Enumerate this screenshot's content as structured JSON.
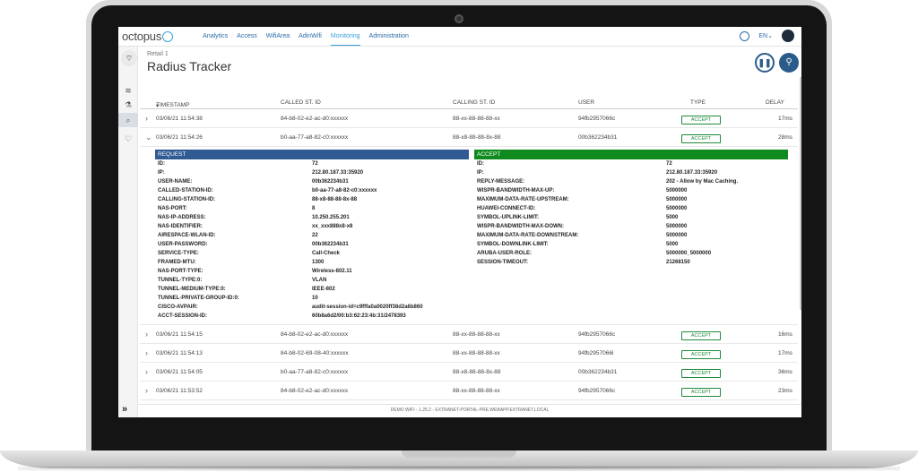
{
  "app": {
    "logo_text": "octopus"
  },
  "nav": [
    "Analytics",
    "Access",
    "WifiArea",
    "AdinWifi",
    "Monitoring",
    "Administration"
  ],
  "nav_active": "Monitoring",
  "lang": "EN",
  "breadcrumb": "Retail 1",
  "page_title": "Radius Tracker",
  "columns": [
    "TIMESTAMP",
    "CALLED ST. ID",
    "CALLING ST. ID",
    "USER",
    "TYPE",
    "DELAY"
  ],
  "rows_top": [
    {
      "timestamp": "03/06/21 11:54:38",
      "called": "84-b8-02-e2-ac-d0:xxxxxx",
      "calling": "88-xx-88-88-88-xx",
      "user": "94fb2957066c",
      "type": "ACCEPT",
      "delay": "17ms"
    },
    {
      "timestamp": "03/06/21 11:54:26",
      "called": "b0-aa-77-a8-82-c0:xxxxxx",
      "calling": "88-x8-88-88-8x-88",
      "user": "00b362234b31",
      "type": "ACCEPT",
      "delay": "28ms"
    }
  ],
  "request": {
    "title": "REQUEST",
    "items": [
      {
        "k": "ID:",
        "v": "72"
      },
      {
        "k": "IP:",
        "v": "212.80.187.33:35920"
      },
      {
        "k": "USER-NAME:",
        "v": "00b362234b31"
      },
      {
        "k": "CALLED-STATION-ID:",
        "v": "b0-aa-77-a8-82-c0:xxxxxx"
      },
      {
        "k": "CALLING-STATION-ID:",
        "v": "88-x8-88-88-8x-88"
      },
      {
        "k": "NAS-PORT:",
        "v": "8"
      },
      {
        "k": "NAS-IP-ADDRESS:",
        "v": "10.250.255.201"
      },
      {
        "k": "NAS-IDENTIFIER:",
        "v": "xx_xxx888x8-x8"
      },
      {
        "k": "AIRESPACE-WLAN-ID:",
        "v": "22"
      },
      {
        "k": "USER-PASSWORD:",
        "v": "00b362234b31"
      },
      {
        "k": "SERVICE-TYPE:",
        "v": "Call-Check"
      },
      {
        "k": "FRAMED-MTU:",
        "v": "1300"
      },
      {
        "k": "NAS-PORT-TYPE:",
        "v": "Wireless-802.11"
      },
      {
        "k": "TUNNEL-TYPE:0:",
        "v": "VLAN"
      },
      {
        "k": "TUNNEL-MEDIUM-TYPE:0:",
        "v": "IEEE-802"
      },
      {
        "k": "TUNNEL-PRIVATE-GROUP-ID:0:",
        "v": "10"
      },
      {
        "k": "CISCO-AVPAIR:",
        "v": "audit-session-id=c9fffa0a0020ff38d2a6b860"
      },
      {
        "k": "ACCT-SESSION-ID:",
        "v": "60b8a6d2/00:b3:62:23:4b:31/2478393"
      }
    ]
  },
  "accept": {
    "title": "ACCEPT",
    "items": [
      {
        "k": "ID:",
        "v": "72"
      },
      {
        "k": "IP:",
        "v": "212.80.187.33:35920"
      },
      {
        "k": "REPLY-MESSAGE:",
        "v": "202 - Allow by Mac Caching."
      },
      {
        "k": "WISPR-BANDWIDTH-MAX-UP:",
        "v": "5000000"
      },
      {
        "k": "MAXIMUM-DATA-RATE-UPSTREAM:",
        "v": "5000000"
      },
      {
        "k": "HUAWEI-CONNECT-ID:",
        "v": "5000000"
      },
      {
        "k": "SYMBOL-UPLINK-LIMIT:",
        "v": "5000"
      },
      {
        "k": "WISPR-BANDWIDTH-MAX-DOWN:",
        "v": "5000000"
      },
      {
        "k": "MAXIMUM-DATA-RATE-DOWNSTREAM:",
        "v": "5000000"
      },
      {
        "k": "SYMBOL-DOWNLINK-LIMIT:",
        "v": "5000"
      },
      {
        "k": "ARUBA-USER-ROLE:",
        "v": "5000000_5000000"
      },
      {
        "k": "SESSION-TIMEOUT:",
        "v": "21268150"
      }
    ]
  },
  "rows_bottom": [
    {
      "timestamp": "03/06/21 11:54:15",
      "called": "84-b8-02-e2-ac-d0:xxxxxx",
      "calling": "88-xx-88-88-88-xx",
      "user": "94fb2957066c",
      "type": "ACCEPT",
      "delay": "16ms"
    },
    {
      "timestamp": "03/06/21 11:54:13",
      "called": "84-b8-02-69-08-40:xxxxxx",
      "calling": "88-xx-88-88-88-xx",
      "user": "94fb2957066l",
      "type": "ACCEPT",
      "delay": "17ms"
    },
    {
      "timestamp": "03/06/21 11:54:05",
      "called": "b0-aa-77-a8-82-c0:xxxxxx",
      "calling": "88-x8-88-88-8x-88",
      "user": "00b362234b31",
      "type": "ACCEPT",
      "delay": "36ms"
    },
    {
      "timestamp": "03/06/21 11:53:52",
      "called": "84-b8-02-e2-ac-d0:xxxxxx",
      "calling": "88-xx-88-88-88-xx",
      "user": "94fb2957066c",
      "type": "ACCEPT",
      "delay": "23ms"
    }
  ],
  "footer": "DEMO WIFI - 1.25.2 - EXTRANET-PORTAL-PRE.WEBAPP.EXTRANET.LOCAL",
  "colors": {
    "request": "#2f5a92",
    "accept": "#0f8a1e",
    "badge": "#1f8a3a",
    "primary": "#2b5b8a"
  }
}
